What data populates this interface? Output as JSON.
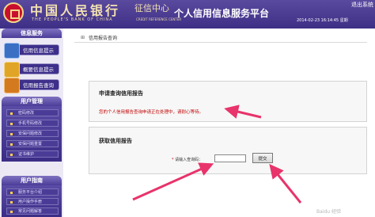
{
  "header": {
    "bank_name": "中国人民银行",
    "bank_name_en": "THE PEOPLE'S BANK OF CHINA",
    "credit_center": "征信中心",
    "credit_center_en": "CREDIT REFERENCE CENTER",
    "platform_title": "个人信用信息服务平台",
    "date_time": "2014-02-23 16:14:45 星期",
    "logout": "退出系统",
    "colors": {
      "bg_top": "#5a4a9e",
      "bg_bottom": "#3e2f86",
      "gold": "#f3e2b0"
    }
  },
  "sidebar": {
    "info_service": {
      "title": "信息服务",
      "items": [
        {
          "label": "信用信息提示",
          "icon": "document-icon"
        },
        {
          "label": "概要信息提示",
          "icon": "folder-icon"
        },
        {
          "label": "信用报告查询",
          "icon": "report-icon"
        }
      ]
    },
    "user_management": {
      "title": "用户管理",
      "items": [
        "密码修改",
        "手机号码修改",
        "安保问题修改",
        "安保问题重置",
        "证书维护"
      ]
    },
    "user_guide": {
      "title": "用户指南",
      "items": [
        "服务平台介绍",
        "用户操作手册",
        "常见问题解答"
      ]
    }
  },
  "main": {
    "breadcrumb": "信用报告查询",
    "apply_box": {
      "title": "申请查询信用报告",
      "message": "您的个人信用报告查询申请正在处理中，请耐心等待。"
    },
    "get_box": {
      "title": "获取信用报告",
      "query_label": "请输入查询码：",
      "required_mark": "*",
      "query_value": "",
      "submit_label": "提交"
    }
  },
  "annotation_color": "#e8336b",
  "watermark": "Baidu 经验"
}
